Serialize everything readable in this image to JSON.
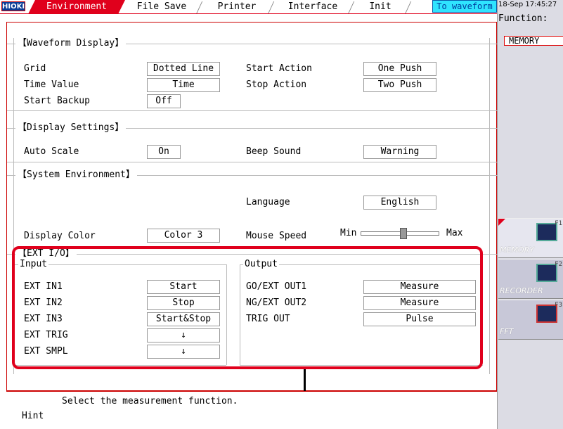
{
  "brand": "HIOKI",
  "tabs": [
    {
      "label": "Environment",
      "active": true
    },
    {
      "label": "File Save",
      "active": false
    },
    {
      "label": "Printer",
      "active": false
    },
    {
      "label": "Interface",
      "active": false
    },
    {
      "label": "Init",
      "active": false
    }
  ],
  "to_waveform": "To waveform",
  "datetime": "18-Sep 17:45:27",
  "function": {
    "label": "Function:",
    "value": "MEMORY"
  },
  "function_buttons": [
    {
      "label": "MEMORY",
      "fkey": "F1",
      "selected": true
    },
    {
      "label": "RECORDER",
      "fkey": "F2",
      "selected": false
    },
    {
      "label": "FFT",
      "fkey": "F3",
      "selected": false
    }
  ],
  "waveform_display": {
    "title": "【Waveform Display】",
    "grid": {
      "label": "Grid",
      "value": "Dotted Line"
    },
    "time_value": {
      "label": "Time Value",
      "value": "Time"
    },
    "start_backup": {
      "label": "Start Backup",
      "value": "Off"
    },
    "start_action": {
      "label": "Start Action",
      "value": "One Push"
    },
    "stop_action": {
      "label": "Stop Action",
      "value": "Two Push"
    }
  },
  "display_settings": {
    "title": "【Display Settings】",
    "auto_scale": {
      "label": "Auto Scale",
      "value": "On"
    },
    "beep_sound": {
      "label": "Beep Sound",
      "value": "Warning"
    }
  },
  "system_environment": {
    "title": "【System Environment】",
    "language": {
      "label": "Language",
      "value": "English"
    },
    "display_color": {
      "label": "Display Color",
      "value": "Color 3"
    },
    "mouse_speed": {
      "label": "Mouse Speed",
      "min": "Min",
      "max": "Max",
      "level_fraction": 0.55
    }
  },
  "ext_io": {
    "title": "【EXT I/O】",
    "input_title": "Input",
    "output_title": "Output",
    "inputs": [
      {
        "label": "EXT IN1",
        "value": "Start"
      },
      {
        "label": "EXT IN2",
        "value": "Stop"
      },
      {
        "label": "EXT IN3",
        "value": "Start&Stop"
      },
      {
        "label": "EXT TRIG",
        "value": "↓"
      },
      {
        "label": "EXT SMPL",
        "value": "↓"
      }
    ],
    "outputs": [
      {
        "label": "GO/EXT OUT1",
        "value": "Measure"
      },
      {
        "label": "NG/EXT OUT2",
        "value": "Measure"
      },
      {
        "label": "TRIG OUT",
        "value": "Pulse"
      }
    ]
  },
  "hint": {
    "label": "Hint",
    "text": "Select the measurement function."
  },
  "colors": {
    "accent": "#e0001c",
    "to_waveform_bg": "#2fe4ff",
    "panel": "#dcdce4"
  }
}
